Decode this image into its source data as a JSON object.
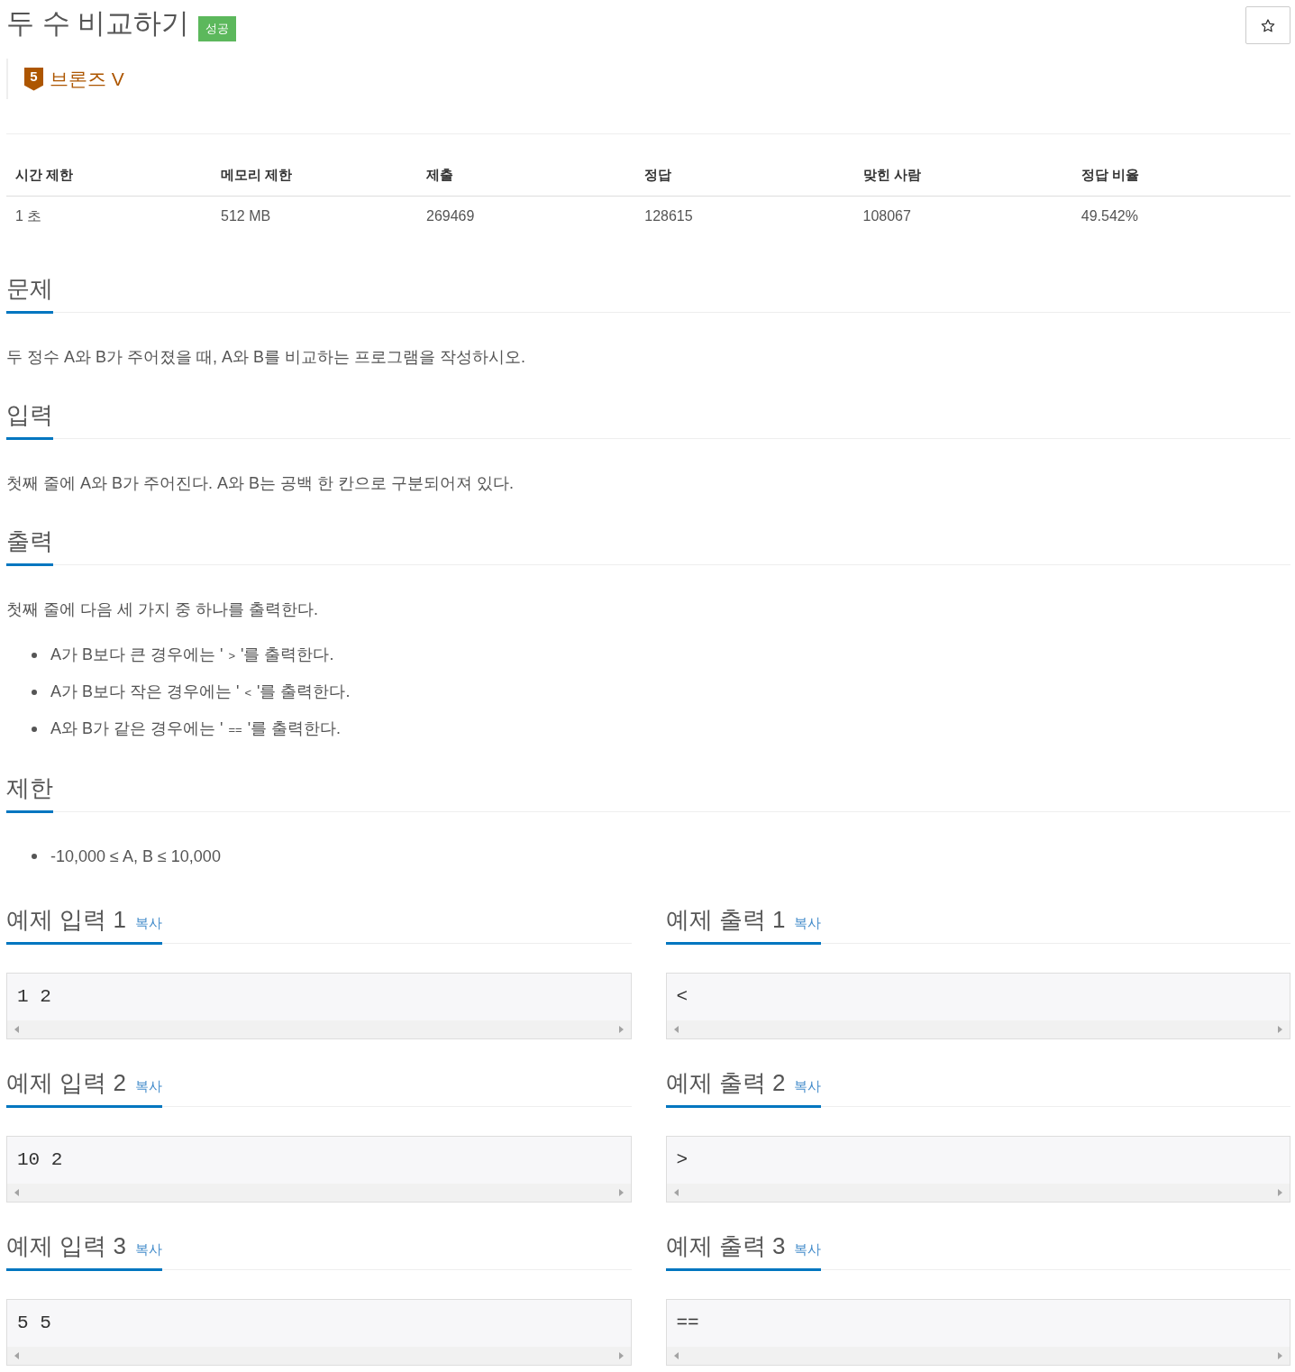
{
  "problem": {
    "title": "두 수 비교하기",
    "result_badge": "성공"
  },
  "tier": {
    "number": "5",
    "label": "브론즈 V"
  },
  "stats": {
    "columns": [
      "시간 제한",
      "메모리 제한",
      "제출",
      "정답",
      "맞힌 사람",
      "정답 비율"
    ],
    "rows": [
      [
        "1 초",
        "512 MB",
        "269469",
        "128615",
        "108067",
        "49.542%"
      ]
    ]
  },
  "sections": [
    {
      "heading": "문제",
      "blocks": [
        {
          "kind": "paragraph",
          "text": "두 정수 A와 B가 주어졌을 때, A와 B를 비교하는 프로그램을 작성하시오."
        }
      ]
    },
    {
      "heading": "입력",
      "blocks": [
        {
          "kind": "paragraph",
          "text": "첫째 줄에 A와 B가 주어진다. A와 B는 공백 한 칸으로 구분되어져 있다."
        }
      ]
    },
    {
      "heading": "출력",
      "blocks": [
        {
          "kind": "paragraph",
          "text": "첫째 줄에 다음 세 가지 중 하나를 출력한다."
        },
        {
          "kind": "list",
          "items": [
            {
              "text": "A가 B보다 큰 경우에는 '",
              "code": ">",
              "text_after": "'를 출력한다."
            },
            {
              "text": "A가 B보다 작은 경우에는 '",
              "code": "<",
              "text_after": "'를 출력한다."
            },
            {
              "text": "A와 B가 같은 경우에는 '",
              "code": "==",
              "text_after": "'를 출력한다."
            }
          ]
        }
      ]
    },
    {
      "heading": "제한",
      "blocks": [
        {
          "kind": "list",
          "items": [
            {
              "text": "-10,000 ≤ A, B ≤ 10,000"
            }
          ]
        }
      ]
    }
  ],
  "samples": [
    {
      "heading": "예제 입력 1",
      "copy_link": "복사",
      "content": "1 2"
    },
    {
      "heading": "예제 출력 1",
      "copy_link": "복사",
      "content": "<"
    },
    {
      "heading": "예제 입력 2",
      "copy_link": "복사",
      "content": "10 2"
    },
    {
      "heading": "예제 출력 2",
      "copy_link": "복사",
      "content": ">"
    },
    {
      "heading": "예제 입력 3",
      "copy_link": "복사",
      "content": "5 5"
    },
    {
      "heading": "예제 출력 3",
      "copy_link": "복사",
      "content": "=="
    }
  ]
}
